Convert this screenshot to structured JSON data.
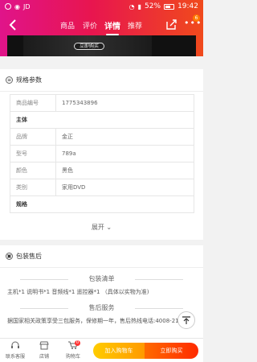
{
  "status_bar": {
    "battery": "52%",
    "time": "19:42"
  },
  "nav": {
    "tabs": [
      "商品",
      "评价",
      "详情",
      "推荐"
    ],
    "active_tab": "详情",
    "more_badge": "6"
  },
  "hero": {
    "buy_now_pill": "立即购买"
  },
  "specs": {
    "title": "规格参数",
    "rows": [
      {
        "key": "商品编号",
        "value": "1775343896",
        "type": "row"
      },
      {
        "key": "主体",
        "value": "",
        "type": "group"
      },
      {
        "key": "品牌",
        "value": "金正",
        "type": "row"
      },
      {
        "key": "型号",
        "value": "789a",
        "type": "row"
      },
      {
        "key": "颜色",
        "value": "黑色",
        "type": "row"
      },
      {
        "key": "类别",
        "value": "家用DVD",
        "type": "row"
      },
      {
        "key": "规格",
        "value": "",
        "type": "group"
      }
    ],
    "expand_label": "展开 ⌄"
  },
  "package": {
    "title": "包装售后",
    "list_title": "包装清单",
    "list_text": "主机*1 说明书*1 音频线*1 遥控器*1 （具体以实物为准)",
    "service_title": "售后服务",
    "service_text": "据国家相关政策享受三包服务，保修期一年，售后热线电话:4008-2199"
  },
  "bottom_bar": {
    "service_label": "联系客服",
    "shop_label": "店铺",
    "cart_label": "购物车",
    "cart_badge": "0",
    "add_cart_label": "加入购物车",
    "buy_label": "立即购买"
  }
}
